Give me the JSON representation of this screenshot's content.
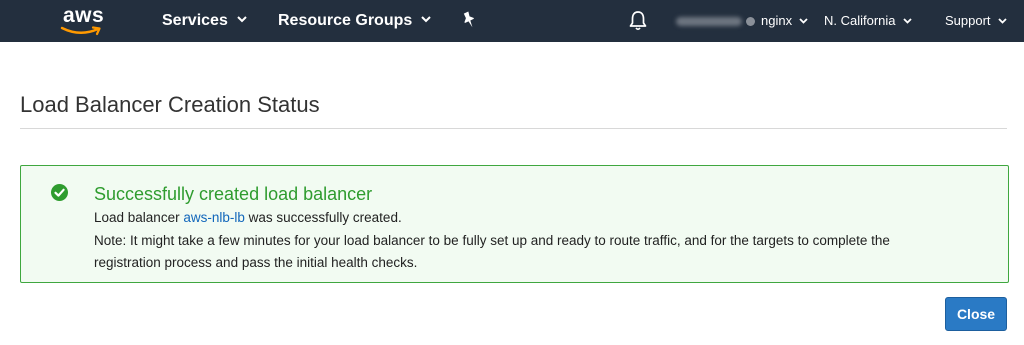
{
  "nav": {
    "logo_text": "aws",
    "services": "Services",
    "resource_groups": "Resource Groups",
    "account": "nginx",
    "region": "N. California",
    "support": "Support",
    "icons": [
      "chevron-down-icon",
      "pin-icon",
      "bell-icon"
    ],
    "bg_color": "#232f3e"
  },
  "page": {
    "title": "Load Balancer Creation Status"
  },
  "alert": {
    "title": "Successfully created load balancer",
    "line1_prefix": "Load balancer",
    "lb_name": "aws-nlb-lb",
    "line1_suffix": "was successfully created.",
    "note_line1": "Note: It might take a few minutes for your load balancer to be fully set up and ready to route traffic, and for the targets to complete the",
    "note_line2": "registration process and pass the initial health checks.",
    "icon": "check-circle-icon",
    "color": "#2f9c2f"
  },
  "actions": {
    "close_label": "Close",
    "close_color": "#2a7ac5"
  }
}
